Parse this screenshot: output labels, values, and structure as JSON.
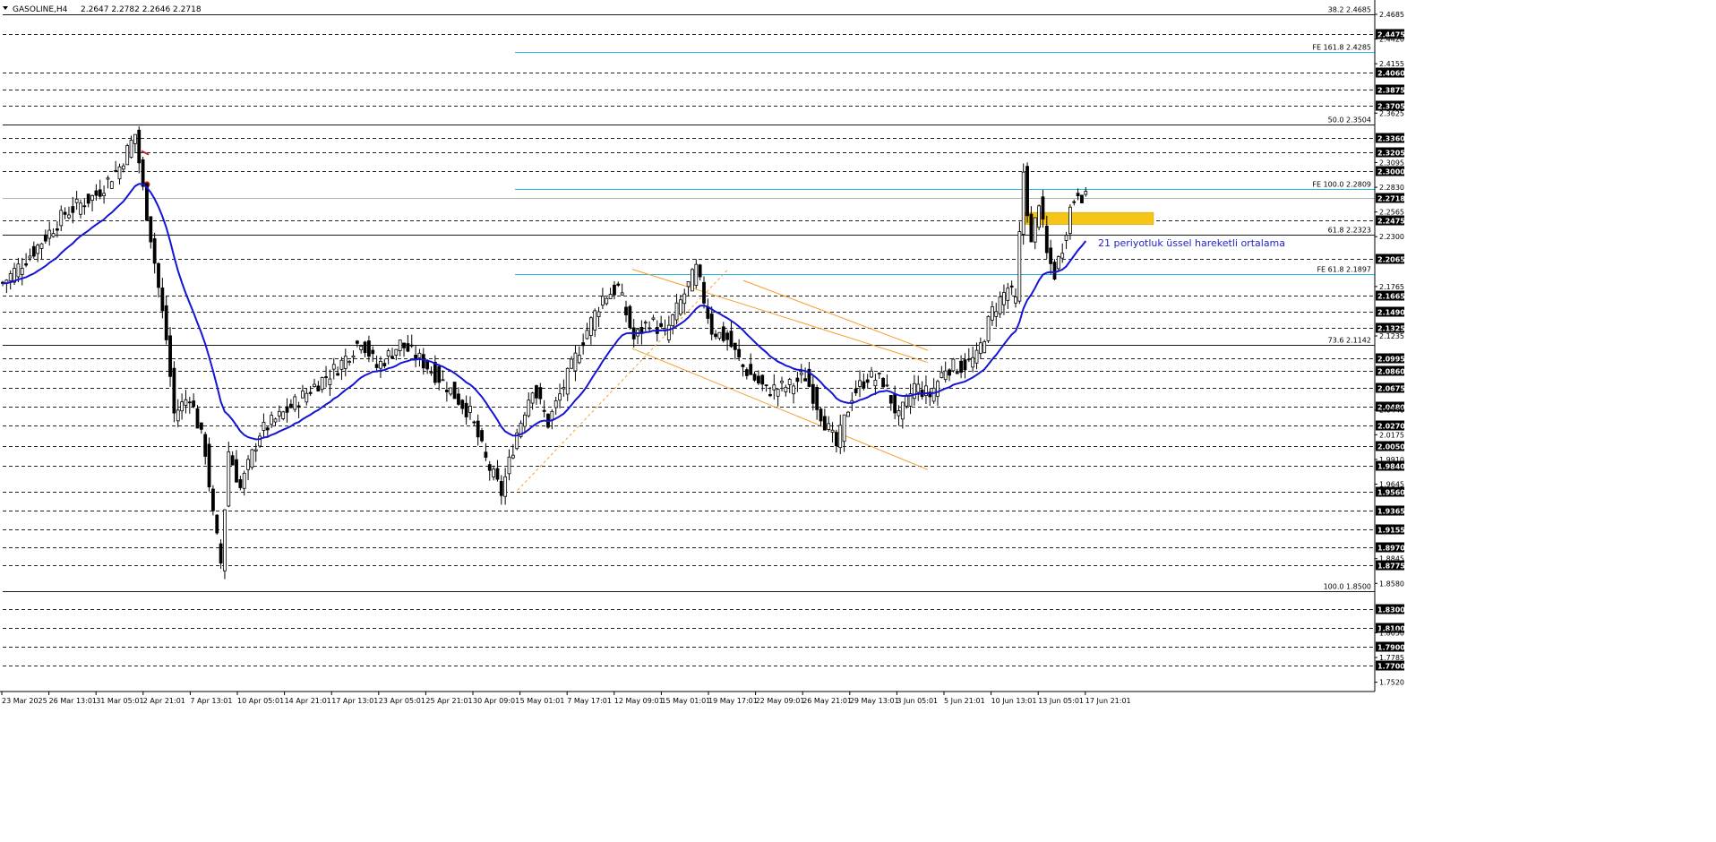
{
  "header": {
    "symbol": "GASOLINE,H4",
    "ohlc": "2.2647 2.2782 2.2646 2.2718"
  },
  "colors": {
    "background": "#ffffff",
    "candle": "#000000",
    "ema": "#1515d6",
    "fibo": "#1a1a1a",
    "fe": "#27b5e6",
    "channel": "#f5a030",
    "zone": "#f5c518",
    "annotation": "#2222cc"
  },
  "chart_data": {
    "type": "candlestick",
    "title": "GASOLINE,H4",
    "ylim": [
      1.742,
      2.481
    ],
    "price_ticks": [
      "2.4685",
      "2.4420",
      "2.4155",
      "2.3625",
      "2.3095",
      "2.2830",
      "2.2565",
      "2.2300",
      "2.1765",
      "2.1235",
      "2.0440",
      "2.0175",
      "1.9910",
      "1.9645",
      "1.8845",
      "1.8580",
      "1.8050",
      "1.7785",
      "1.7520"
    ],
    "x_ticks": [
      "23 Mar 2025",
      "26 Mar 13:01",
      "31 Mar 05:01",
      "2 Apr 21:01",
      "7 Apr 13:01",
      "10 Apr 05:01",
      "14 Apr 21:01",
      "17 Apr 13:01",
      "23 Apr 05:01",
      "25 Apr 21:01",
      "30 Apr 09:01",
      "5 May 01:01",
      "7 May 17:01",
      "12 May 09:01",
      "15 May 01:01",
      "19 May 17:01",
      "22 May 09:01",
      "26 May 21:01",
      "29 May 13:01",
      "3 Jun 05:01",
      "5 Jun 21:01",
      "10 Jun 13:01",
      "13 Jun 05:01",
      "17 Jun 21:01"
    ],
    "current_price": "2.2718",
    "horizontal_levels": [
      "2.4475",
      "2.4060",
      "2.3875",
      "2.3705",
      "2.3360",
      "2.3205",
      "2.3000",
      "2.2475",
      "2.2065",
      "2.1665",
      "2.1490",
      "2.1325",
      "2.0995",
      "2.0860",
      "2.0675",
      "2.0480",
      "2.0270",
      "2.0050",
      "1.9840",
      "1.9560",
      "1.9365",
      "1.9155",
      "1.8970",
      "1.8775",
      "1.8300",
      "1.8100",
      "1.7900",
      "1.7700"
    ],
    "fibonacci": [
      {
        "label": "38.2 2.4685",
        "price": 2.4685
      },
      {
        "label": "50.0 2.3504",
        "price": 2.3504
      },
      {
        "label": "61.8 2.2323",
        "price": 2.2323
      },
      {
        "label": "73.6 2.1142",
        "price": 2.1142
      },
      {
        "label": "100.0 1.8500",
        "price": 1.85
      }
    ],
    "fibo_expansion": [
      {
        "label": "FE 161.8 2.4285",
        "price": 2.4285
      },
      {
        "label": "FE 100.0 2.2809",
        "price": 2.2809
      },
      {
        "label": "FE 61.8 2.1897",
        "price": 2.1897
      }
    ],
    "ema_label": "21 periyotluk üssel hareketli ortalama",
    "price_anchors": [
      [
        0,
        2.18
      ],
      [
        8,
        2.215
      ],
      [
        16,
        2.255
      ],
      [
        24,
        2.275
      ],
      [
        30,
        2.305
      ],
      [
        34,
        2.34
      ],
      [
        36,
        2.28
      ],
      [
        38,
        2.23
      ],
      [
        42,
        2.12
      ],
      [
        44,
        2.04
      ],
      [
        48,
        2.06
      ],
      [
        52,
        2.0
      ],
      [
        54,
        1.93
      ],
      [
        56,
        1.88
      ],
      [
        58,
        2.0
      ],
      [
        61,
        1.96
      ],
      [
        66,
        2.02
      ],
      [
        72,
        2.04
      ],
      [
        80,
        2.07
      ],
      [
        86,
        2.09
      ],
      [
        92,
        2.12
      ],
      [
        96,
        2.09
      ],
      [
        102,
        2.115
      ],
      [
        108,
        2.095
      ],
      [
        114,
        2.07
      ],
      [
        120,
        2.04
      ],
      [
        124,
        1.99
      ],
      [
        128,
        1.955
      ],
      [
        132,
        2.02
      ],
      [
        136,
        2.07
      ],
      [
        140,
        2.03
      ],
      [
        146,
        2.09
      ],
      [
        150,
        2.13
      ],
      [
        154,
        2.165
      ],
      [
        158,
        2.175
      ],
      [
        162,
        2.12
      ],
      [
        166,
        2.14
      ],
      [
        170,
        2.125
      ],
      [
        174,
        2.16
      ],
      [
        178,
        2.195
      ],
      [
        182,
        2.13
      ],
      [
        186,
        2.12
      ],
      [
        190,
        2.09
      ],
      [
        196,
        2.065
      ],
      [
        202,
        2.07
      ],
      [
        206,
        2.08
      ],
      [
        210,
        2.04
      ],
      [
        214,
        2.005
      ],
      [
        218,
        2.06
      ],
      [
        222,
        2.08
      ],
      [
        226,
        2.075
      ],
      [
        230,
        2.035
      ],
      [
        234,
        2.07
      ],
      [
        238,
        2.06
      ],
      [
        242,
        2.09
      ],
      [
        246,
        2.09
      ],
      [
        250,
        2.1
      ],
      [
        254,
        2.15
      ],
      [
        258,
        2.175
      ],
      [
        260,
        2.16
      ],
      [
        262,
        2.3
      ],
      [
        264,
        2.22
      ],
      [
        266,
        2.27
      ],
      [
        268,
        2.21
      ],
      [
        270,
        2.19
      ],
      [
        272,
        2.22
      ],
      [
        274,
        2.26
      ],
      [
        276,
        2.28
      ],
      [
        278,
        2.27
      ]
    ]
  }
}
